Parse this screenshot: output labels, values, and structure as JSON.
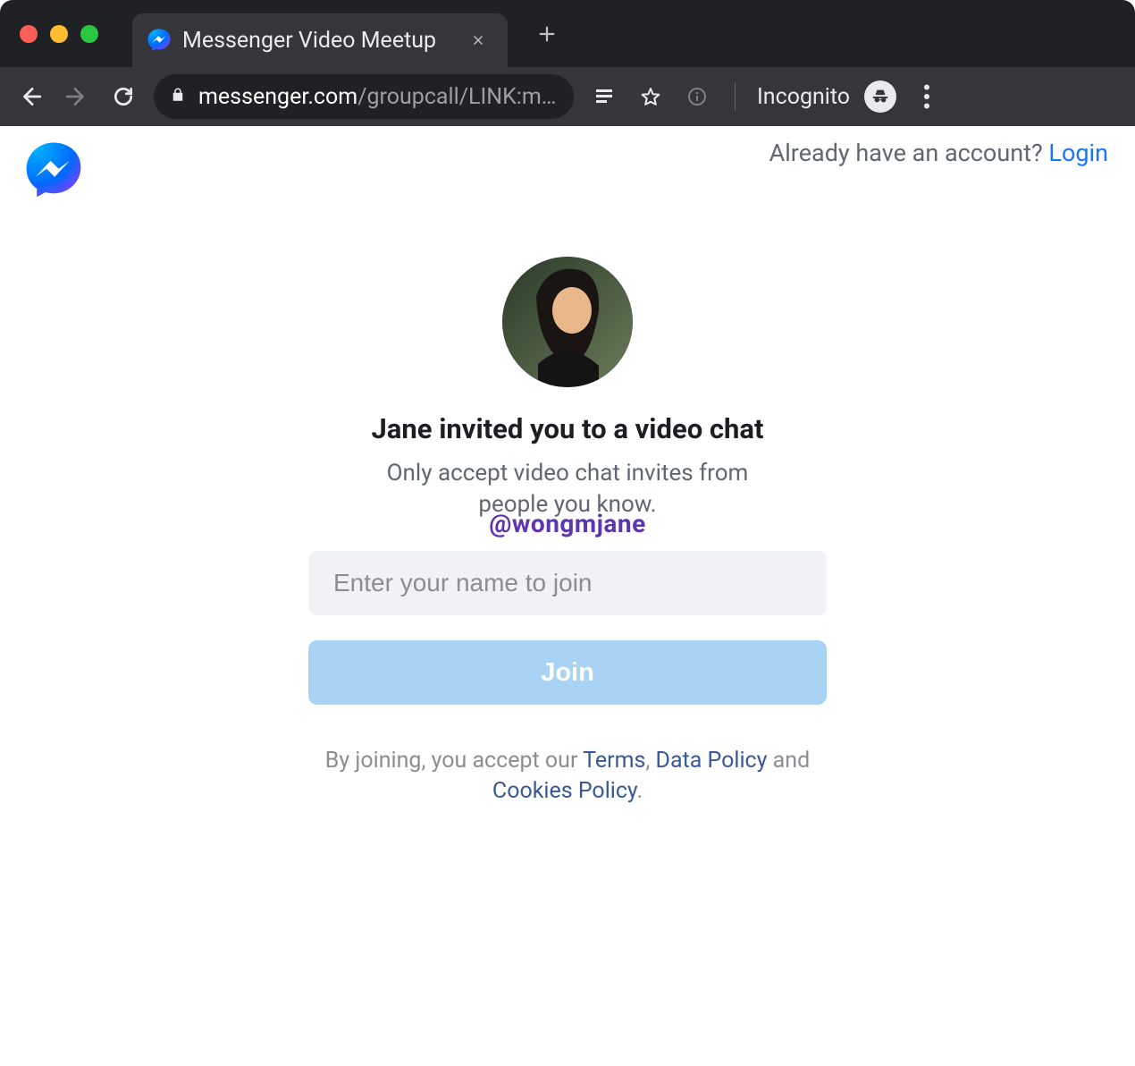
{
  "browser": {
    "tab_title": "Messenger Video Meetup",
    "url_domain": "messenger.com",
    "url_path": "/groupcall/LINK:m…",
    "incognito_label": "Incognito"
  },
  "header": {
    "account_prompt": "Already have an account? ",
    "login_label": "Login"
  },
  "main": {
    "headline": "Jane invited you to a video chat",
    "subline": "Only accept video chat invites from people you know.",
    "handle_overlay": "@wongmjane",
    "name_placeholder": "Enter your name to join",
    "join_label": "Join"
  },
  "disclaimer": {
    "prefix": "By joining, you accept our ",
    "terms": "Terms",
    "sep1": ", ",
    "data_policy": "Data Policy",
    "sep2": " and ",
    "cookies_policy": "Cookies Policy",
    "suffix": "."
  }
}
